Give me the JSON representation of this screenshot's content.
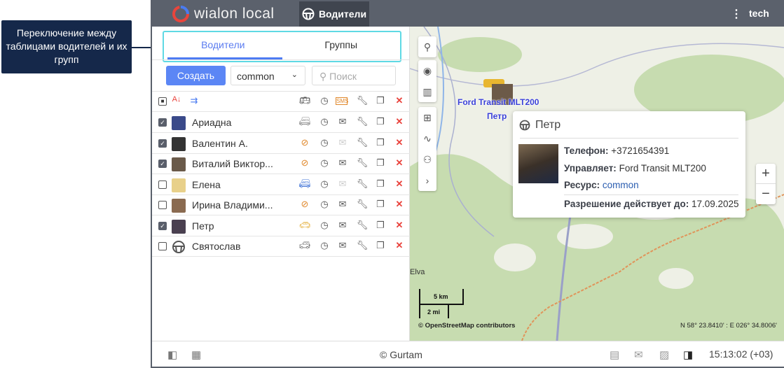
{
  "callout": {
    "text": "Переключение между таблицами водителей и их групп"
  },
  "header": {
    "logo": "wialon local",
    "active_tab": "Водители",
    "user": "tech",
    "menu_icon": "⋮"
  },
  "panel": {
    "tabs": [
      {
        "label": "Водители",
        "active": true
      },
      {
        "label": "Группы",
        "active": false
      }
    ],
    "create_label": "Создать",
    "resource_select": "common",
    "search_placeholder": "Поиск",
    "header_icons": [
      "select-all",
      "sort-az",
      "group",
      "unit",
      "history",
      "sms",
      "settings",
      "copy",
      "delete"
    ],
    "drivers": [
      {
        "name": "Ариадна",
        "checked": true,
        "unit": "white-van",
        "message_enabled": true
      },
      {
        "name": "Валентин А.",
        "checked": true,
        "unit": "unbound",
        "message_enabled": false
      },
      {
        "name": "Виталий Виктор...",
        "checked": true,
        "unit": "unbound",
        "message_enabled": true
      },
      {
        "name": "Елена",
        "checked": false,
        "unit": "blue-van",
        "message_enabled": false
      },
      {
        "name": "Ирина Владими...",
        "checked": false,
        "unit": "unbound",
        "message_enabled": true
      },
      {
        "name": "Петр",
        "checked": true,
        "unit": "yellow-car",
        "message_enabled": true
      },
      {
        "name": "Святослав",
        "checked": false,
        "unit": "gray-suv",
        "message_enabled": true
      }
    ]
  },
  "map": {
    "unit_label": "Ford Transit MLT200",
    "driver_label": "Петр",
    "place_label": "Elva",
    "scale_km": "5 km",
    "scale_mi": "2 mi",
    "attribution": "© OpenStreetMap contributors",
    "coords": "N 58° 23.8410' : E 026° 34.8006'",
    "popup": {
      "title": "Петр",
      "phone_label": "Телефон:",
      "phone": "+3721654391",
      "drives_label": "Управляет:",
      "drives": "Ford Transit MLT200",
      "resource_label": "Ресурс:",
      "resource": "common",
      "permit_label": "Разрешение действует до:",
      "permit": "17.09.2025"
    }
  },
  "footer": {
    "copyright": "© Gurtam",
    "time": "15:13:02 (+03)"
  }
}
